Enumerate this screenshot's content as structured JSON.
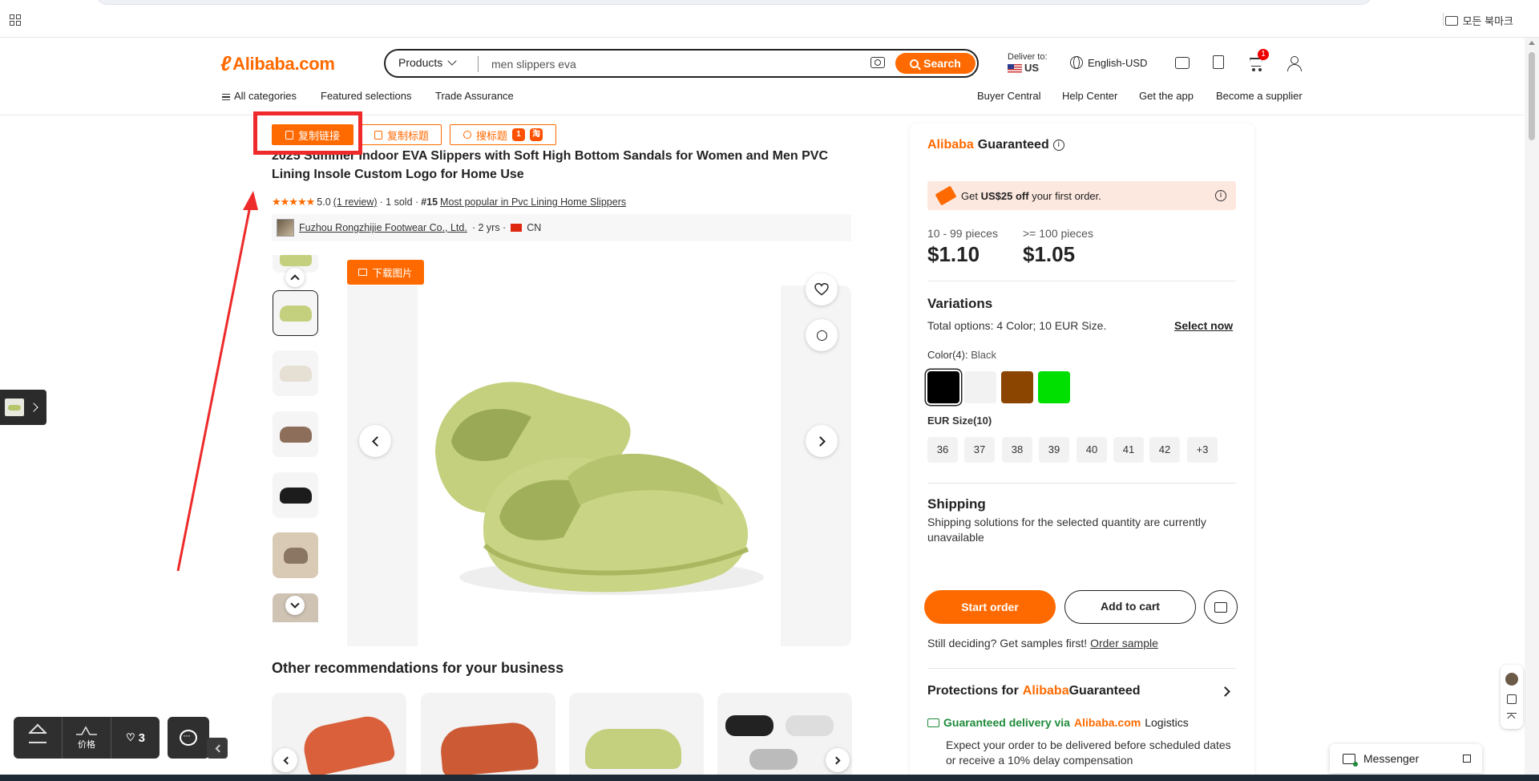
{
  "browser": {
    "bookmarks_label": "모든 북마크"
  },
  "header": {
    "logo_text": "Alibaba.com",
    "search": {
      "category": "Products",
      "query": "men slippers eva",
      "button_label": "Search"
    },
    "deliver_to_label": "Deliver to:",
    "deliver_country": "US",
    "language": "English-USD",
    "cart_count": "1"
  },
  "subnav": {
    "left": [
      "All categories",
      "Featured selections",
      "Trade Assurance"
    ],
    "right": [
      "Buyer Central",
      "Help Center",
      "Get the app",
      "Become a supplier"
    ]
  },
  "toolbar": {
    "copy_link": "复制链接",
    "copy_title": "复制标题",
    "search_title": "搜标题",
    "tag1": "1",
    "tag2": "淘"
  },
  "product": {
    "title_line1": "2025 Summer Indoor EVA Slippers with Soft High Bottom Sandals for Women and Men PVC",
    "title_line2": "Lining Insole Custom Logo for Home Use",
    "stars": "★★★★★",
    "rating": "5.0",
    "reviews": "(1 review)",
    "sold": "· 1 sold ·",
    "rank": "#15",
    "rank_link": "Most popular in Pvc Lining Home Slippers",
    "supplier": "Fuzhou Rongzhijie Footwear Co., Ltd.",
    "supplier_years": "· 2 yrs ·",
    "supplier_country": "CN",
    "download_images": "下载图片"
  },
  "recommendations_title": "Other recommendations for your business",
  "panel": {
    "guaranteed_brand": "Alibaba",
    "guaranteed_word": "Guaranteed",
    "promo_prefix": "Get",
    "promo_amount": "US$25 off",
    "promo_suffix": "your first order.",
    "tiers": [
      {
        "range": "10 - 99 pieces",
        "price": "$1.10"
      },
      {
        "range": ">= 100 pieces",
        "price": "$1.05"
      }
    ],
    "variations_title": "Variations",
    "total_options_label": "Total options:",
    "total_options": "4 Color; 10 EUR Size.",
    "select_now": "Select now",
    "color_label": "Color(4):",
    "color_selected": "Black",
    "colors": [
      "#000000",
      "#f2f2f2",
      "#8b4500",
      "#00e000"
    ],
    "size_label": "EUR Size(10)",
    "sizes": [
      "36",
      "37",
      "38",
      "39",
      "40",
      "41",
      "42",
      "+3"
    ],
    "shipping_title": "Shipping",
    "shipping_text": "Shipping solutions for the selected quantity are currently unavailable",
    "start_order": "Start order",
    "add_to_cart": "Add to cart",
    "sample_text": "Still deciding? Get samples first!",
    "order_sample": "Order sample",
    "protections_prefix": "Protections for",
    "delivery_title": "Guaranteed delivery via",
    "delivery_brand": "Alibaba.com",
    "delivery_logistics": "Logistics",
    "delivery_desc": "Expect your order to be delivered before scheduled dates or receive a 10% delay compensation"
  },
  "widgets": {
    "price_label": "价格",
    "favorites_count": "3",
    "messenger": "Messenger"
  },
  "colors": {
    "accent": "#ff6a00",
    "highlight": "#ee2a2a",
    "slipper": "#c4d07e"
  }
}
